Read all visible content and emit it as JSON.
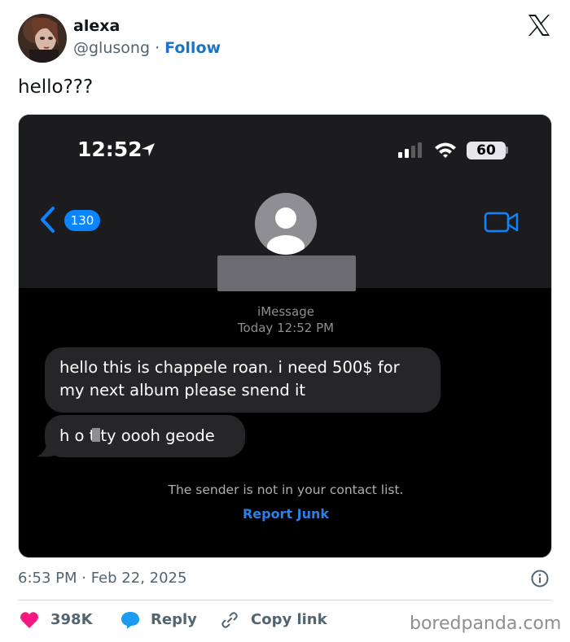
{
  "author": {
    "display_name": "alexa",
    "handle": "@glusong",
    "separator": "·",
    "follow_label": "Follow"
  },
  "tweet": {
    "text": "hello???",
    "timestamp": "6:53 PM · Feb 22, 2025"
  },
  "phone": {
    "clock": "12:52",
    "battery": "60",
    "back_count": "130",
    "service": "iMessage",
    "time_line": "Today 12:52 PM",
    "messages": [
      "hello this is chappele roan. i need 500$ for my next album please snend it"
    ],
    "message_2_prefix": "h o t",
    "message_2_suffix": "ty oooh geode",
    "notice": "The sender is not in your contact list.",
    "report_label": "Report Junk"
  },
  "actions": {
    "likes": "398K",
    "reply_label": "Reply",
    "copy_label": "Copy link"
  },
  "watermark": "boredpanda.com",
  "colors": {
    "accent": "#1d74c7",
    "heart": "#f91880",
    "imessage_blue": "#0a84ff"
  }
}
